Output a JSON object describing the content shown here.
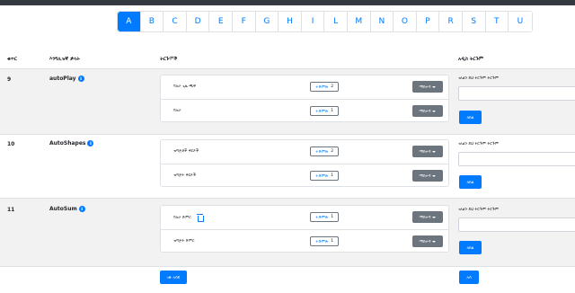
{
  "alphabet": [
    "A",
    "B",
    "C",
    "D",
    "E",
    "F",
    "G",
    "H",
    "I",
    "L",
    "M",
    "N",
    "O",
    "P",
    "R",
    "S",
    "T",
    "U"
  ],
  "active_letter": "A",
  "table": {
    "headers": {
      "number": "ቁጥር",
      "feature": "እንግሊዝኛ ቃላት",
      "translations": "ትርጉሞች",
      "suggest": "አዲስ ትርጉም"
    },
    "rows": [
      {
        "number": "9",
        "feature": "autoPlay",
        "terms": [
          {
            "label": "ባለራ ጊዜ ጫዋ",
            "vote_label": "+ድምጽ",
            "vote_count": "2",
            "manage_label": "ማስተዳ",
            "trash": false
          },
          {
            "label": "ባለራ",
            "vote_label": "+ድምጽ",
            "vote_count": "1",
            "manage_label": "ማስተዳ",
            "trash": false
          }
        ],
        "suggest_prompt": "ገለልን ይህ ትርጉም ትርጉም",
        "add_label": "አክል"
      },
      {
        "number": "10",
        "feature": "AutoShapes",
        "terms": [
          {
            "label": "ዝግጅቶች ቅርጾች",
            "vote_label": "+ድምጽ",
            "vote_count": "2",
            "manage_label": "ማስተዳ",
            "trash": false
          },
          {
            "label": "ዝግጅት ቅርጾች",
            "vote_label": "+ድምጽ",
            "vote_count": "1",
            "manage_label": "ማስተዳ",
            "trash": false
          }
        ],
        "suggest_prompt": "ገለልን ይህ ትርጉም ትርጉም",
        "add_label": "አክል"
      },
      {
        "number": "11",
        "feature": "AutoSum",
        "terms": [
          {
            "label": "ባለራ ድምር",
            "vote_label": "+ድምጽ",
            "vote_count": "1",
            "manage_label": "ማስተዳ",
            "trash": true
          },
          {
            "label": "ዝግጅት ድምር",
            "vote_label": "+ድምጽ",
            "vote_count": "1",
            "manage_label": "ማስተዳ",
            "trash": false
          }
        ],
        "suggest_prompt": "ገለልን ይህ ትርጉም ትርጉም",
        "add_label": "አክል"
      }
    ]
  },
  "footer": {
    "left_button": "ገጽ አሳይ",
    "right_button": "አሳ"
  }
}
